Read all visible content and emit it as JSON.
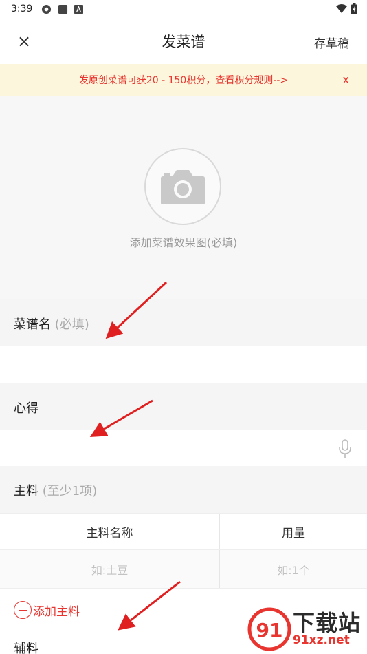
{
  "status_bar": {
    "time": "3:39"
  },
  "header": {
    "title": "发菜谱",
    "close_label": "×",
    "draft_label": "存草稿"
  },
  "banner": {
    "text": "发原创菜谱可获20 - 150积分，查看积分规则-->",
    "close_label": "x"
  },
  "photo": {
    "label": "添加菜谱效果图(必填)",
    "icon": "camera-icon"
  },
  "recipe_name": {
    "label": "菜谱名",
    "hint": "(必填)"
  },
  "tips": {
    "label": "心得",
    "icon": "microphone-icon"
  },
  "main_ingredients": {
    "label": "主料",
    "hint": "(至少1项)",
    "columns": [
      "主料名称",
      "用量"
    ],
    "placeholder_name": "如:土豆",
    "placeholder_qty": "如:1个",
    "add_label": "添加主料"
  },
  "aux_ingredients": {
    "label": "辅料"
  },
  "watermark": {
    "logo_text": "下载站",
    "url": "91xz.net",
    "logo_mark": "91"
  },
  "colors": {
    "accent": "#e8352f",
    "banner_bg": "#fbf6dc",
    "section_bg": "#f5f5f5"
  }
}
